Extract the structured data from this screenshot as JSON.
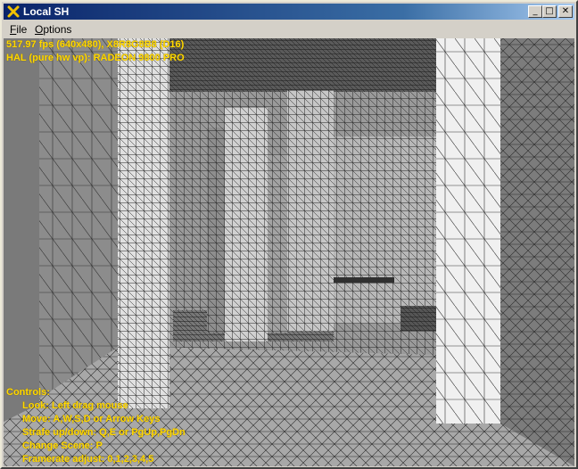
{
  "window": {
    "title": "Local SH",
    "minimize_glyph": "_",
    "maximize_glyph": "□",
    "close_glyph": "✕"
  },
  "menu": {
    "items": [
      {
        "label": "File",
        "accel": "F",
        "rest": "ile"
      },
      {
        "label": "Options",
        "accel": "O",
        "rest": "ptions"
      }
    ]
  },
  "hud": {
    "stats_line": "517.97 fps (640x480), X8R8G8B8 (D16)",
    "device_line": "HAL (pure hw vp): RADEON 9800 PRO",
    "controls_heading": "Controls:",
    "controls": [
      "Look: Left drag mouse",
      "Move: A,W,S,D or Arrow Keys",
      "Strafe up/down: Q,E or PgUp,PgDn",
      "Change Scene: P",
      "Framerate adjust: 0,1,2,3,4,5"
    ],
    "text_color": "#ffd800"
  },
  "icons": {
    "app": "x-logo-icon",
    "minimize": "minimize-icon",
    "maximize": "maximize-icon",
    "close": "close-icon"
  },
  "colors": {
    "titlebar_start": "#0a246a",
    "titlebar_end": "#a6caf0",
    "chrome": "#d4d0c8"
  }
}
